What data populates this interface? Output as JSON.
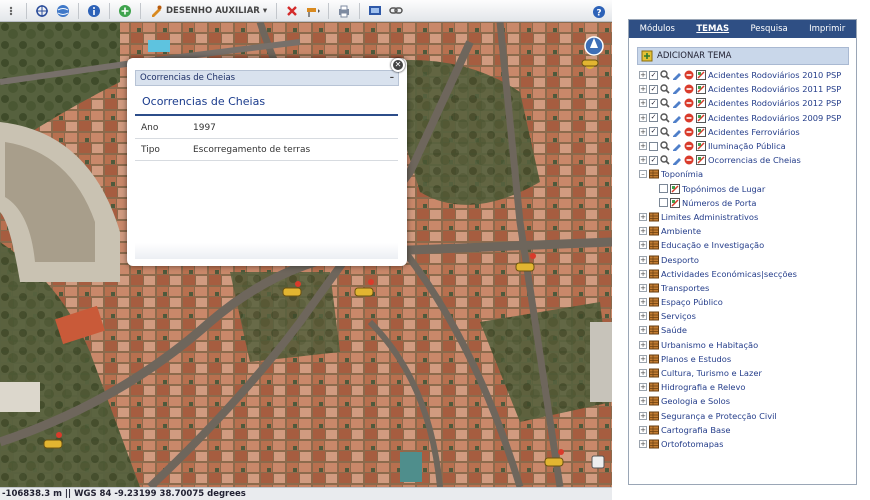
{
  "toolbar": {
    "drawing_label": "DESENHO AUXILIAR",
    "icons": [
      "globe-icon",
      "zoom-extent-icon",
      "layers-icon",
      "info-icon",
      "add-icon",
      "drawing-icon",
      "delete-icon",
      "measure-icon",
      "print-icon",
      "export-icon",
      "link-icon",
      "help-icon"
    ]
  },
  "statusbar": {
    "text": "-106838.3 m || WGS 84   -9.23199 38.70075 degrees"
  },
  "popup": {
    "header": "Ocorrencias de Cheias",
    "title": "Ocorrencias de Cheias",
    "rows": [
      {
        "key": "Ano",
        "value": "1997"
      },
      {
        "key": "Tipo",
        "value": "Escorregamento de terras"
      }
    ]
  },
  "panel": {
    "tabs": [
      "Módulos",
      "TEMAS",
      "Pesquisa",
      "Imprimir"
    ],
    "active_tab": "TEMAS",
    "add_theme": "ADICIONAR TEMA",
    "layers": [
      {
        "label": "Acidentes Rodoviários 2010 PSP",
        "checked": true
      },
      {
        "label": "Acidentes Rodoviários 2011 PSP",
        "checked": true
      },
      {
        "label": "Acidentes Rodoviários 2012 PSP",
        "checked": true
      },
      {
        "label": "Acidentes Rodoviários 2009 PSP",
        "checked": true
      },
      {
        "label": "Acidentes Ferroviários",
        "checked": true
      },
      {
        "label": "Iluminação Pública",
        "checked": false
      },
      {
        "label": "Ocorrencias de Cheias",
        "checked": true
      }
    ],
    "toponimia": {
      "label": "Toponímia",
      "children": [
        "Topónimos de Lugar",
        "Números de Porta"
      ]
    },
    "groups": [
      "Limites Administrativos",
      "Ambiente",
      "Educação e Investigação",
      "Desporto",
      "Actividades Económicas|secções",
      "Transportes",
      "Espaço Público",
      "Serviços",
      "Saúde",
      "Urbanismo e Habitação",
      "Planos e Estudos",
      "Cultura, Turismo e Lazer",
      "Hidrografia e Relevo",
      "Geologia e Solos",
      "Segurança e Protecção Civil",
      "Cartografia Base",
      "Ortofotomapas"
    ]
  },
  "colors": {
    "panel_tab_bg": "#2f4f84",
    "layer_text": "#243d8a",
    "popup_rule": "#2c4d8a"
  }
}
